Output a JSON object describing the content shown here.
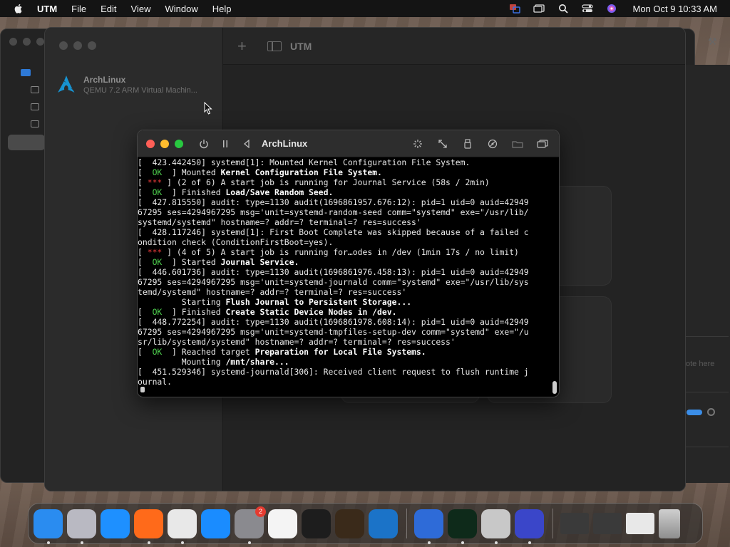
{
  "menubar": {
    "app": "UTM",
    "items": [
      "File",
      "Edit",
      "View",
      "Window",
      "Help"
    ],
    "clock": "Mon Oct 9  10:33 AM"
  },
  "utm": {
    "toolbar_title": "UTM",
    "vm": {
      "name": "ArchLinux",
      "description": "QEMU 7.2 ARM Virtual Machin..."
    },
    "right_panel_note": "ote here"
  },
  "console": {
    "title": "ArchLinux",
    "lines": [
      [
        {
          "t": "[  423.442450] systemd[1]: Mounted Kernel Configuration File System."
        }
      ],
      [
        {
          "t": "[  "
        },
        {
          "t": "OK",
          "c": "ok"
        },
        {
          "t": "  ] Mounted "
        },
        {
          "t": "Kernel Configuration File System.",
          "c": "bold"
        }
      ],
      [
        {
          "t": "[ "
        },
        {
          "t": "***",
          "c": "warn"
        },
        {
          "t": " ] (2 of 6) A start job is running for Journal Service (58s / 2min)"
        }
      ],
      [
        {
          "t": "[  "
        },
        {
          "t": "OK",
          "c": "ok"
        },
        {
          "t": "  ] Finished "
        },
        {
          "t": "Load/Save Random Seed.",
          "c": "bold"
        }
      ],
      [
        {
          "t": "[  427.815550] audit: type=1130 audit(1696861957.676:12): pid=1 uid=0 auid=42949"
        }
      ],
      [
        {
          "t": "67295 ses=4294967295 msg='unit=systemd-random-seed comm=\"systemd\" exe=\"/usr/lib/"
        }
      ],
      [
        {
          "t": "systemd/systemd\" hostname=? addr=? terminal=? res=success'"
        }
      ],
      [
        {
          "t": "[  428.117246] systemd[1]: First Boot Complete was skipped because of a failed c"
        }
      ],
      [
        {
          "t": "ondition check (ConditionFirstBoot=yes)."
        }
      ],
      [
        {
          "t": "[ "
        },
        {
          "t": "***",
          "c": "warn"
        },
        {
          "t": " ] (4 of 5) A start job is running for…odes in /dev (1min 17s / no limit)"
        }
      ],
      [
        {
          "t": "[  "
        },
        {
          "t": "OK",
          "c": "ok"
        },
        {
          "t": "  ] Started "
        },
        {
          "t": "Journal Service.",
          "c": "bold"
        }
      ],
      [
        {
          "t": "[  446.601736] audit: type=1130 audit(1696861976.458:13): pid=1 uid=0 auid=42949"
        }
      ],
      [
        {
          "t": "67295 ses=4294967295 msg='unit=systemd-journald comm=\"systemd\" exe=\"/usr/lib/sys"
        }
      ],
      [
        {
          "t": "temd/systemd\" hostname=? addr=? terminal=? res=success'"
        }
      ],
      [
        {
          "t": "         Starting "
        },
        {
          "t": "Flush Journal to Persistent Storage...",
          "c": "bold"
        }
      ],
      [
        {
          "t": "[  "
        },
        {
          "t": "OK",
          "c": "ok"
        },
        {
          "t": "  ] Finished "
        },
        {
          "t": "Create Static Device Nodes in /dev.",
          "c": "bold"
        }
      ],
      [
        {
          "t": "[  448.772254] audit: type=1130 audit(1696861978.608:14): pid=1 uid=0 auid=42949"
        }
      ],
      [
        {
          "t": "67295 ses=4294967295 msg='unit=systemd-tmpfiles-setup-dev comm=\"systemd\" exe=\"/u"
        }
      ],
      [
        {
          "t": "sr/lib/systemd/systemd\" hostname=? addr=? terminal=? res=success'"
        }
      ],
      [
        {
          "t": "[  "
        },
        {
          "t": "OK",
          "c": "ok"
        },
        {
          "t": "  ] Reached target "
        },
        {
          "t": "Preparation for Local File Systems.",
          "c": "bold"
        }
      ],
      [
        {
          "t": "         Mounting "
        },
        {
          "t": "/mnt/share...",
          "c": "bold"
        }
      ],
      [
        {
          "t": "[  451.529346] systemd-journald[306]: Received client request to flush runtime j"
        }
      ],
      [
        {
          "t": "ournal."
        }
      ]
    ]
  },
  "dock": {
    "items": [
      {
        "name": "finder-icon",
        "color": "#2a8cf0",
        "running": true
      },
      {
        "name": "launchpad-icon",
        "color": "#b9b9c2",
        "running": true
      },
      {
        "name": "safari-icon",
        "color": "#1e90ff",
        "running": false
      },
      {
        "name": "firefox-icon",
        "color": "#ff6a1a",
        "running": true
      },
      {
        "name": "chrome-icon",
        "color": "#e8e8e8",
        "running": true
      },
      {
        "name": "app-store-icon",
        "color": "#1a8cff",
        "running": false
      },
      {
        "name": "system-settings-icon",
        "color": "#8a8a8f",
        "running": true,
        "badge": "2"
      },
      {
        "name": "textedit-icon",
        "color": "#f4f4f4",
        "running": false
      },
      {
        "name": "terminal-icon",
        "color": "#1d1d1d",
        "running": false
      },
      {
        "name": "garageband-icon",
        "color": "#3a2a1a",
        "running": false
      },
      {
        "name": "vscode-icon",
        "color": "#1b73c8",
        "running": false
      }
    ],
    "items2": [
      {
        "name": "utm-icon",
        "color": "#2e6bd8",
        "running": true
      },
      {
        "name": "activity-terminal-icon",
        "color": "#0e2a1a",
        "running": true
      },
      {
        "name": "installer-icon",
        "color": "#c8c8c8",
        "running": true
      },
      {
        "name": "qemu-icon",
        "color": "#3a46c9",
        "running": true
      }
    ]
  }
}
